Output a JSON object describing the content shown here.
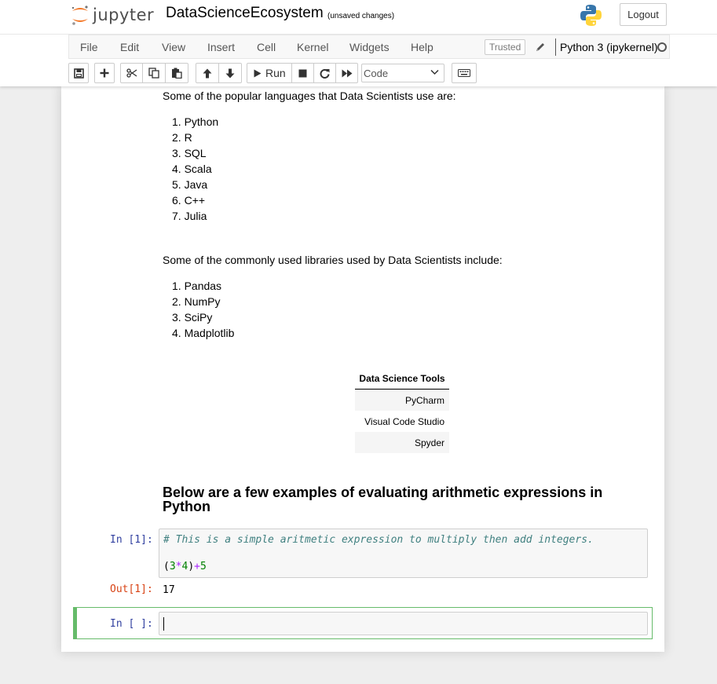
{
  "header": {
    "logo_text": "jupyter",
    "notebook_name": "DataScienceEcosystem",
    "save_status": "(unsaved changes)",
    "logout_label": "Logout"
  },
  "menubar": {
    "items": [
      "File",
      "Edit",
      "View",
      "Insert",
      "Cell",
      "Kernel",
      "Widgets",
      "Help"
    ],
    "trusted_label": "Trusted",
    "kernel_name": "Python 3 (ipykernel)"
  },
  "toolbar": {
    "run_label": "Run",
    "cell_type": "Code"
  },
  "cells": {
    "languages_intro": "Some of the popular languages that Data Scientists use are:",
    "languages": [
      "Python",
      "R",
      "SQL",
      "Scala",
      "Java",
      "C++",
      "Julia"
    ],
    "libraries_intro": "Some of the commonly used libraries used by Data Scientists include:",
    "libraries": [
      "Pandas",
      "NumPy",
      "SciPy",
      "Madplotlib"
    ],
    "tools_table": {
      "header": "Data Science Tools",
      "rows": [
        "PyCharm",
        "Visual Code Studio",
        "Spyder"
      ]
    },
    "arith_heading": "Below are a few examples of evaluating arithmetic expressions in Python",
    "code_cell": {
      "in_prompt": "In [1]:",
      "comment": "# This is a simple aritmetic expression to multiply then add integers.",
      "code_tokens": [
        "(",
        "3",
        "*",
        "4",
        ")",
        "+",
        "5"
      ],
      "out_prompt": "Out[1]:",
      "output": "17"
    },
    "empty_cell": {
      "in_prompt": "In [ ]:"
    }
  },
  "colors": {
    "in_prompt": "#303f9f",
    "out_prompt": "#d84315",
    "selected_cell_border": "#66bb6a",
    "comment": "#408080"
  }
}
